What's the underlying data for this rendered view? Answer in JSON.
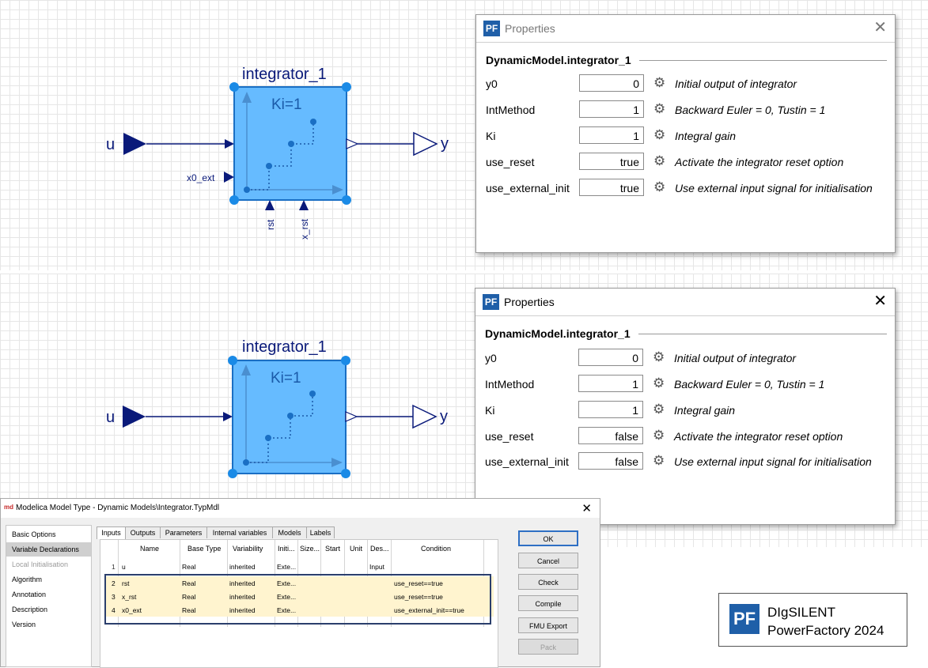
{
  "diagram_top": {
    "block_title": "integrator_1",
    "gain_label": "Ki=1",
    "input_label": "u",
    "output_label": "y",
    "extra_inputs": {
      "x0_ext": "x0_ext",
      "rst": "rst",
      "x_rst": "x_rst"
    }
  },
  "diagram_bottom": {
    "block_title": "integrator_1",
    "gain_label": "Ki=1",
    "input_label": "u",
    "output_label": "y"
  },
  "properties_top": {
    "title": "Properties",
    "icon_text": "PF",
    "heading": "DynamicModel.integrator_1",
    "rows": [
      {
        "name": "y0",
        "value": "0",
        "desc": "Initial output of integrator"
      },
      {
        "name": "IntMethod",
        "value": "1",
        "desc": "Backward Euler = 0, Tustin = 1"
      },
      {
        "name": "Ki",
        "value": "1",
        "desc": "Integral gain"
      },
      {
        "name": "use_reset",
        "value": "true",
        "desc": "Activate the integrator reset option"
      },
      {
        "name": "use_external_init",
        "value": "true",
        "desc": "Use external input signal for initialisation"
      }
    ]
  },
  "properties_bottom": {
    "title": "Properties",
    "icon_text": "PF",
    "heading": "DynamicModel.integrator_1",
    "rows": [
      {
        "name": "y0",
        "value": "0",
        "desc": "Initial output of integrator"
      },
      {
        "name": "IntMethod",
        "value": "1",
        "desc": "Backward Euler = 0, Tustin = 1"
      },
      {
        "name": "Ki",
        "value": "1",
        "desc": "Integral gain"
      },
      {
        "name": "use_reset",
        "value": "false",
        "desc": "Activate the integrator reset option"
      },
      {
        "name": "use_external_init",
        "value": "false",
        "desc": "Use external input signal for initialisation"
      }
    ]
  },
  "modelica_dialog": {
    "title": "Modelica Model Type - Dynamic Models\\Integrator.TypMdl",
    "icon_text": "md",
    "left_nav": [
      "Basic Options",
      "Variable Declarations",
      "Local Initialisation",
      "Algorithm",
      "Annotation",
      "Description",
      "Version"
    ],
    "tabs": [
      "Inputs",
      "Outputs",
      "Parameters",
      "Internal variables",
      "Models",
      "Labels"
    ],
    "columns": [
      "Name",
      "Base Type",
      "Variability",
      "Initi...",
      "Size...",
      "Start",
      "Unit",
      "Des...",
      "Condition"
    ],
    "rows": [
      {
        "num": "1",
        "name": "u",
        "base_type": "Real",
        "variability": "inherited",
        "init": "Exte...",
        "desc": "Input",
        "condition": ""
      },
      {
        "num": "2",
        "name": "rst",
        "base_type": "Real",
        "variability": "inherited",
        "init": "Exte...",
        "desc": "",
        "condition": "use_reset==true"
      },
      {
        "num": "3",
        "name": "x_rst",
        "base_type": "Real",
        "variability": "inherited",
        "init": "Exte...",
        "desc": "",
        "condition": "use_reset==true"
      },
      {
        "num": "4",
        "name": "x0_ext",
        "base_type": "Real",
        "variability": "inherited",
        "init": "Exte...",
        "desc": "",
        "condition": "use_external_init==true"
      }
    ],
    "buttons": [
      "OK",
      "Cancel",
      "Check",
      "Compile",
      "FMU Export",
      "Pack"
    ]
  },
  "logo": {
    "mark": "PF",
    "line1": "DIgSILENT",
    "line2": "PowerFactory 2024"
  },
  "colors": {
    "block_fill": "#66bbff",
    "block_stroke": "#1a6fc4",
    "signal": "#0a1a7a",
    "pf_blue": "#1f5fa8",
    "highlight": "#fff4cf"
  }
}
